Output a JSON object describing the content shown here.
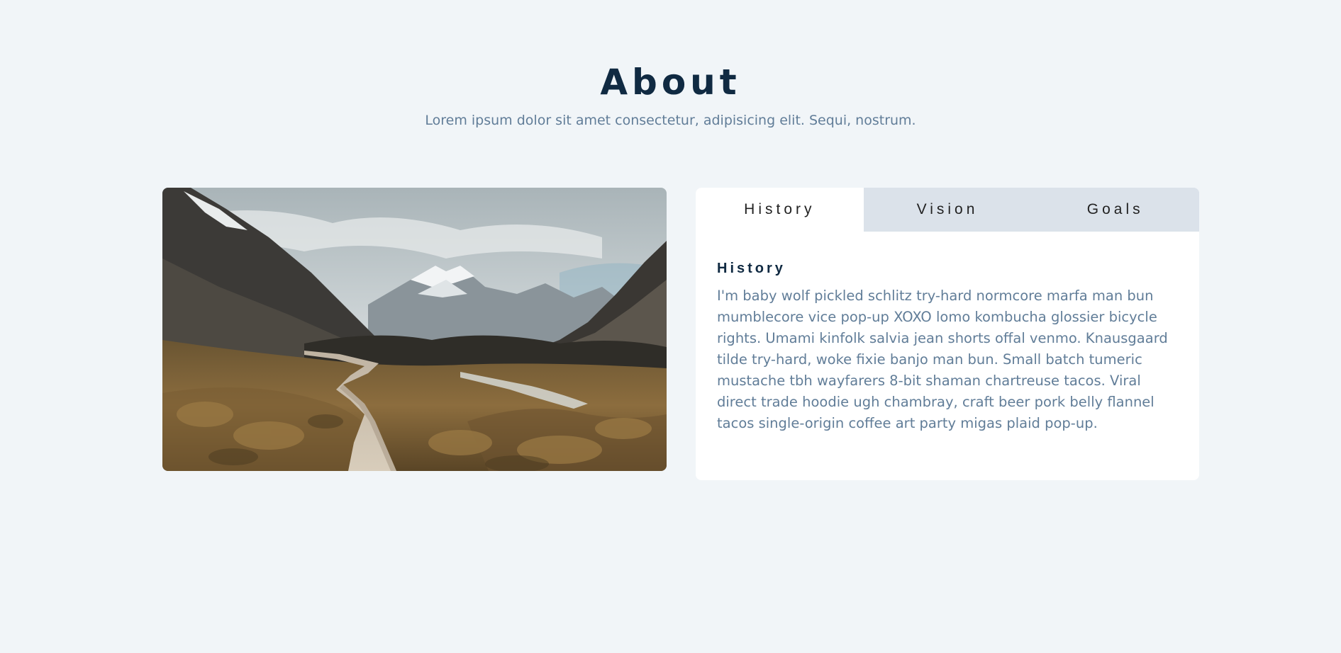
{
  "header": {
    "title": "About",
    "subtitle": "Lorem ipsum dolor sit amet consectetur, adipisicing elit. Sequi, nostrum."
  },
  "image": {
    "subject": "mountain-valley-boardwalk-photo"
  },
  "tabs": [
    {
      "label": "History",
      "active": true
    },
    {
      "label": "Vision",
      "active": false
    },
    {
      "label": "Goals",
      "active": false
    }
  ],
  "content": {
    "heading": "History",
    "body": "I'm baby wolf pickled schlitz try-hard normcore marfa man bun mumblecore vice pop-up XOXO lomo kombucha glossier bicycle rights. Umami kinfolk salvia jean shorts offal venmo. Knausgaard tilde try-hard, woke fixie banjo man bun. Small batch tumeric mustache tbh wayfarers 8-bit shaman chartreuse tacos. Viral direct trade hoodie ugh chambray, craft beer pork belly flannel tacos single-origin coffee art party migas plaid pop-up."
  },
  "colors": {
    "background": "#f1f5f8",
    "heading": "#102a42",
    "body_text": "#617d98",
    "tab_inactive": "#dbe2ea",
    "tab_active": "#ffffff"
  }
}
